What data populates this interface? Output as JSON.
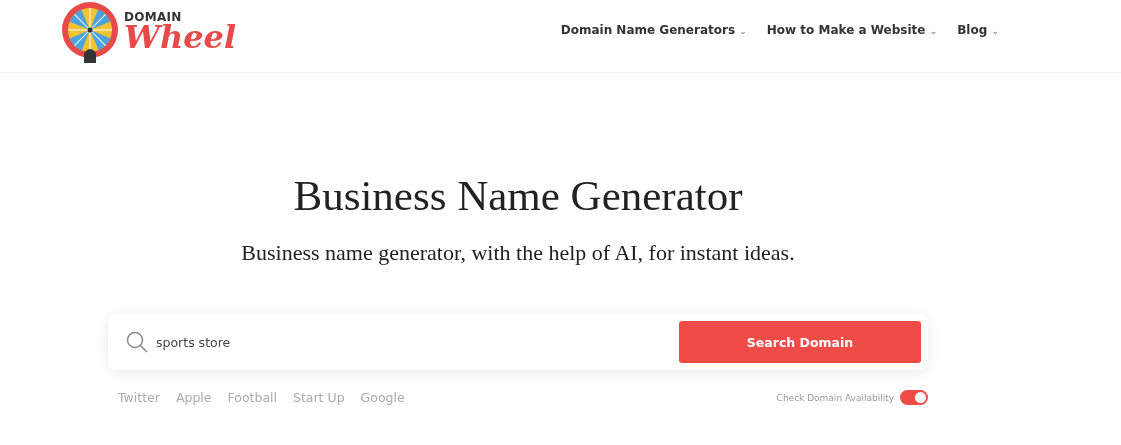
{
  "logo": {
    "top": "DOMAIN",
    "bottom": "Wheel"
  },
  "nav": [
    {
      "label": "Domain Name Generators",
      "caret": "⌄"
    },
    {
      "label": "How to Make a Website",
      "caret": "⌄"
    },
    {
      "label": "Blog",
      "caret": "⌄"
    }
  ],
  "hero": {
    "title": "Business Name Generator",
    "subtitle": "Business name generator, with the help of AI, for instant ideas."
  },
  "search": {
    "value": "sports store",
    "button": "Search Domain"
  },
  "suggestions": [
    "Twitter",
    "Apple",
    "Football",
    "Start Up",
    "Google"
  ],
  "availability": {
    "label": "Check Domain Availability",
    "on": true
  }
}
